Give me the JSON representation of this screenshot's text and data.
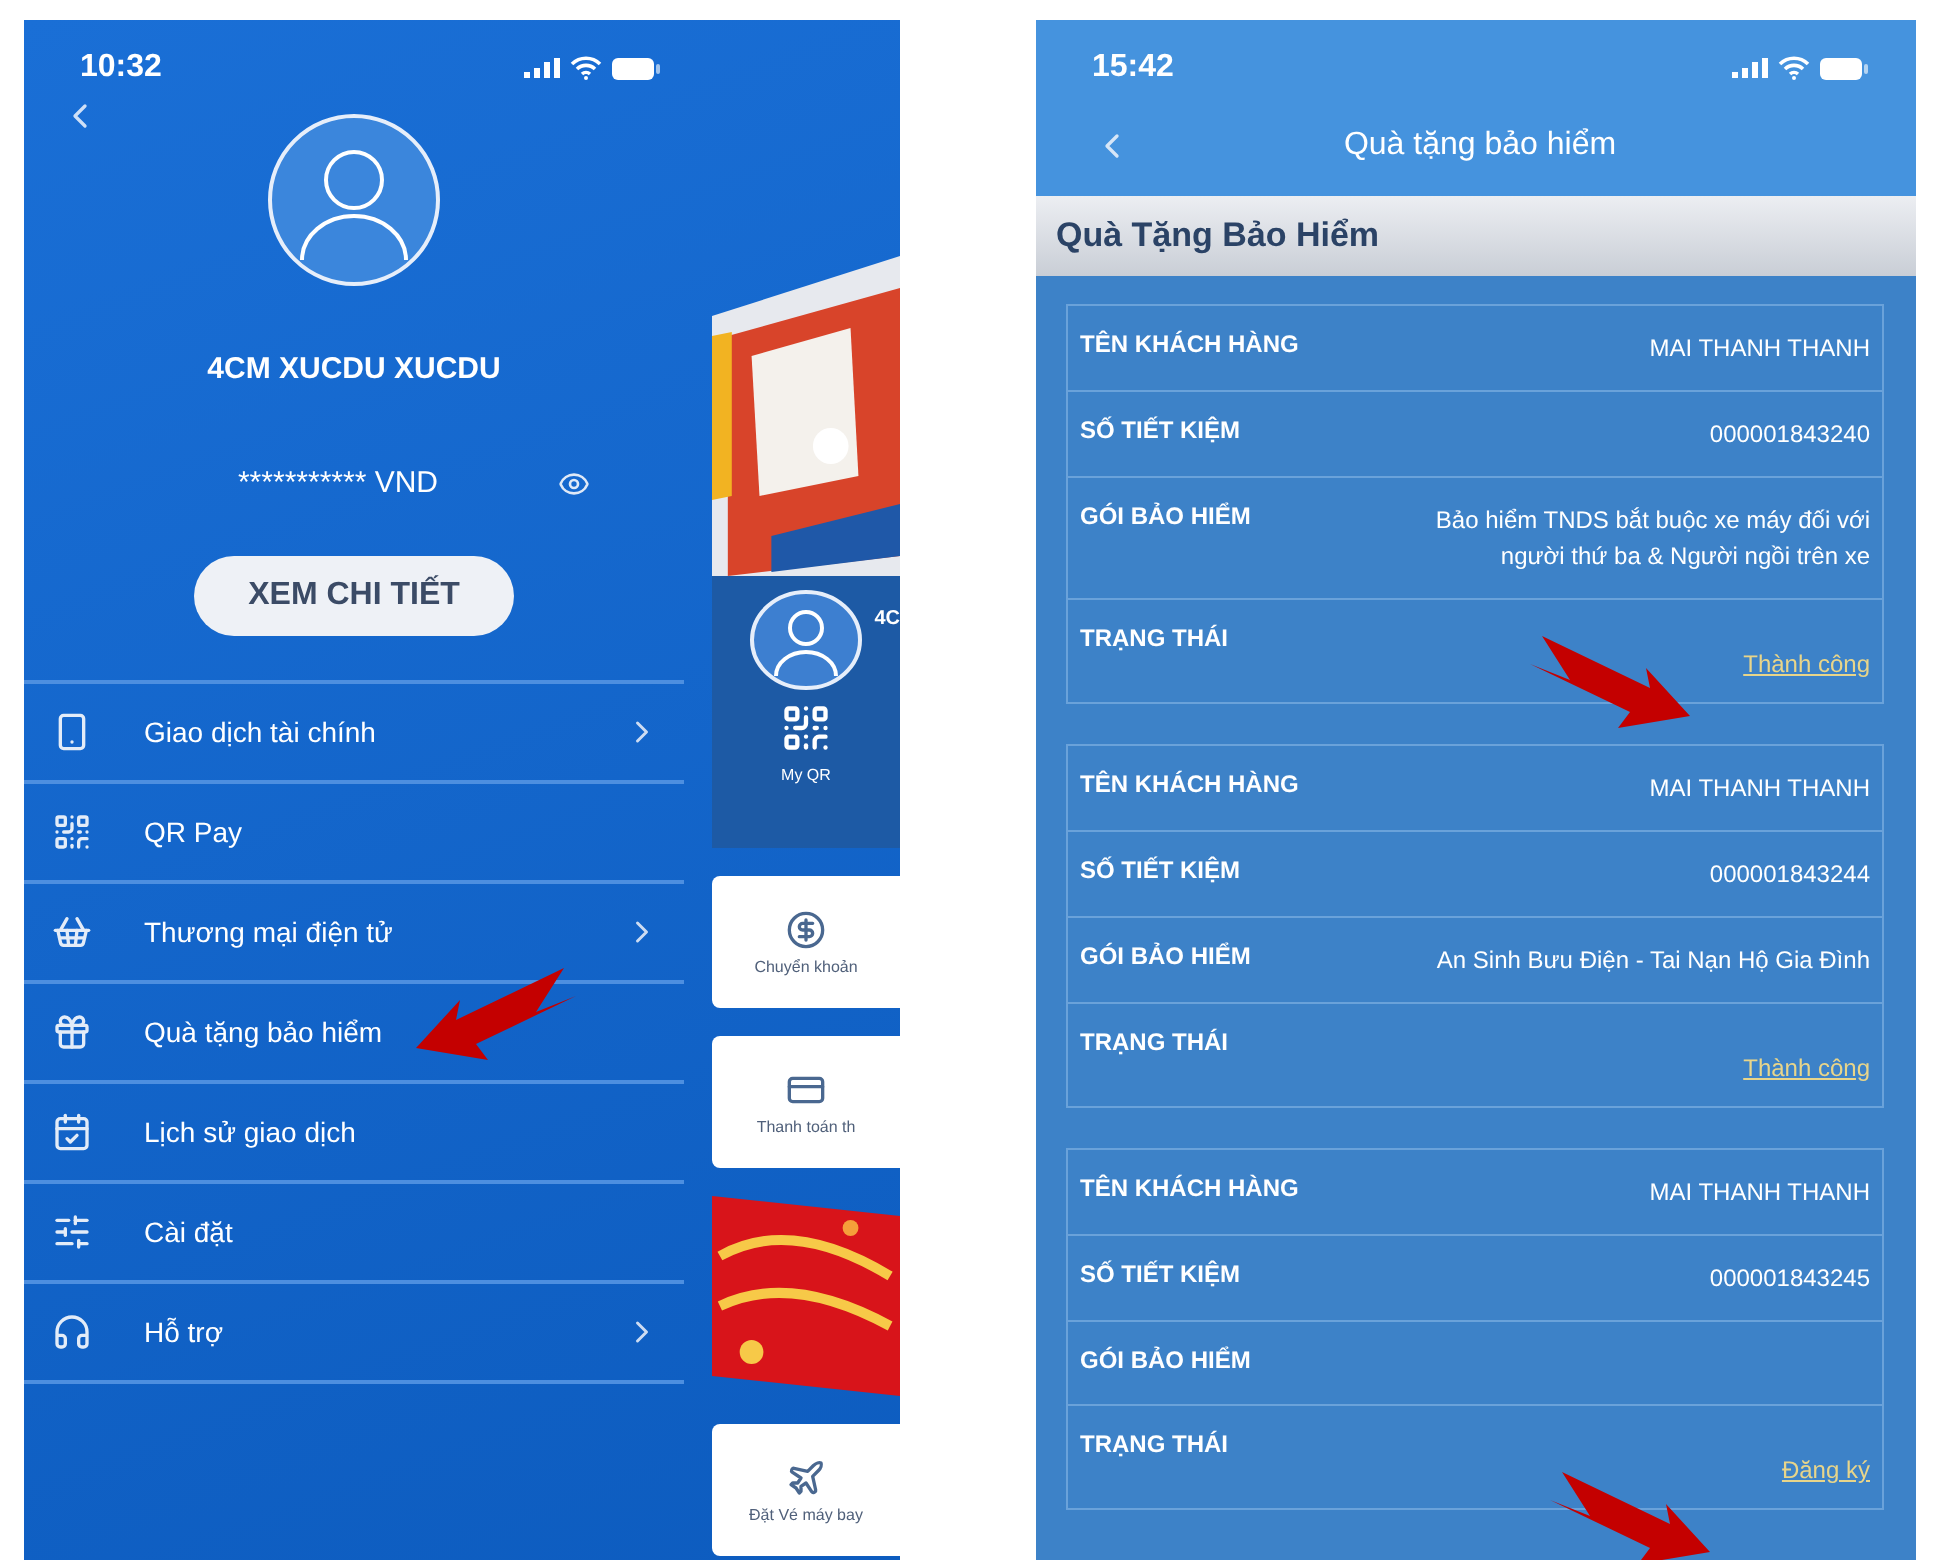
{
  "left_phone": {
    "status_bar": {
      "time": "10:32"
    },
    "profile": {
      "name": "4CM XUCDU XUCDU",
      "balance": "*********** VND",
      "details_button": "XEM CHI TIẾT"
    },
    "menu": [
      {
        "label": "Giao dịch tài chính",
        "has_submenu": true
      },
      {
        "label": "QR Pay",
        "has_submenu": false
      },
      {
        "label": "Thương mại điện tử",
        "has_submenu": true
      },
      {
        "label": "Quà tặng bảo hiểm",
        "has_submenu": false
      },
      {
        "label": "Lịch sử giao dịch",
        "has_submenu": false
      },
      {
        "label": "Cài đặt",
        "has_submenu": false
      },
      {
        "label": "Hỗ trợ",
        "has_submenu": true
      }
    ],
    "home_preview": {
      "name": "4C",
      "tiles": [
        {
          "kind": "qr",
          "label": "My QR"
        },
        {
          "kind": "transfer",
          "label": "Chuyển khoản"
        },
        {
          "kind": "card",
          "label": "Thanh toán th"
        },
        {
          "kind": "banner"
        },
        {
          "kind": "flight",
          "label": "Đặt Vé máy bay"
        }
      ]
    }
  },
  "right_phone": {
    "status_bar": {
      "time": "15:42"
    },
    "nav_title": "Quà tặng bảo hiểm",
    "section_title": "Quà Tặng Bảo Hiểm",
    "records": [
      {
        "rows": [
          {
            "label": "TÊN KHÁCH HÀNG",
            "value": "MAI THANH THANH"
          },
          {
            "label": "SỐ TIẾT KIỆM",
            "value": "000001843240"
          },
          {
            "label": "GÓI BẢO HIỂM",
            "value": "Bảo hiểm TNDS bắt buộc xe máy đối với người thứ ba & Người ngồi trên xe"
          },
          {
            "label": "TRẠNG THÁI",
            "value": "Thành công",
            "kind": "link"
          }
        ]
      },
      {
        "rows": [
          {
            "label": "TÊN KHÁCH HÀNG",
            "value": "MAI THANH THANH"
          },
          {
            "label": "SỐ TIẾT KIỆM",
            "value": "000001843244"
          },
          {
            "label": "GÓI BẢO HIỂM",
            "value": "An Sinh Bưu Điện - Tai Nạn Hộ Gia Đình"
          },
          {
            "label": "TRẠNG THÁI",
            "value": "Thành công",
            "kind": "link"
          }
        ]
      },
      {
        "rows": [
          {
            "label": "TÊN KHÁCH HÀNG",
            "value": "MAI THANH THANH"
          },
          {
            "label": "SỐ TIẾT KIỆM",
            "value": "000001843245"
          },
          {
            "label": "GÓI BẢO HIỂM"
          },
          {
            "label": "TRẠNG THÁI",
            "value": "Đăng ký",
            "kind": "link"
          }
        ]
      }
    ]
  }
}
